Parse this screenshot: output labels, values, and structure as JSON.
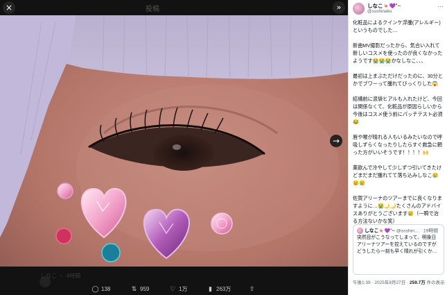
{
  "viewer": {
    "header_title": "投稿",
    "close_icon": "×",
    "collapse_icon": "»",
    "next_icon": "→",
    "ghost_author": "しなこ ・ 4時間"
  },
  "stats": {
    "replies": "138",
    "reposts": "959",
    "likes": "1万",
    "views": "263万",
    "share": ""
  },
  "post": {
    "display_name": "しなこ🍬💜˚‧·",
    "handle": "@ssshinako",
    "more_icon": "···",
    "paragraphs": [
      "化粧品によるクインケ浮腫(アレルギー)というものでした…",
      "新曲MV撮影だったから、気合い入れて新しいコスメを使ったのが良くなかったようです😭😭😭かなしなこ、、、",
      "最初は上まぶただけだったのに、30分とかでブワーって腫れてびっくりした😱",
      "結構前に涙袋ヒアルも入れたけど、今回は関係なくて、化粧品が原因らしいから今後はコスメ使う前にパッチテスト必須😂",
      "唇や喉が晴れる人もいるみたいなので呼吸しずらくなったりしたらすぐ救急に頼った方がいいそうです！！！！🙌",
      "薬飲んで冷やして少しずつ引いてきたけどまだまだ腫れてて落ち込みしなこ😢😢😢",
      "佐賀アリーナのツアーまでに良くなりますように…😭🌙🌙たくさんのアドバイスありがとうございます😢（一瞬で治る方法ないかな笑）"
    ],
    "quote": {
      "name": "しなこ🍬💜˚‧·",
      "meta": "@ssshin… · 19時間",
      "text": "突然目がこうなってしまって、明後日アリーナツアーを控えているのですがどうしたら一刻も早く晴れが引くか…"
    },
    "time": "午後1:39 · 2025年8月27日 · ",
    "views_count": "259.7万",
    "views_label": " 件の表示"
  }
}
